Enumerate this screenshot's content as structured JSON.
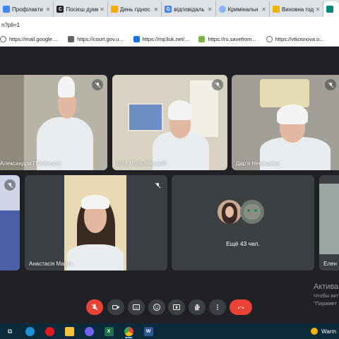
{
  "browser": {
    "tabs": [
      {
        "title": "Профілакти",
        "favicon": "doc-icon",
        "color": "#4285f4",
        "glyph": ""
      },
      {
        "title": "Посієш думк",
        "favicon": "site-icon",
        "color": "#202124",
        "glyph": "C"
      },
      {
        "title": "День гіднос",
        "favicon": "bookmark-icon",
        "color": "#f9ab00",
        "glyph": ""
      },
      {
        "title": "відповідаль",
        "favicon": "google-icon",
        "color": "#4285f4",
        "glyph": "G"
      },
      {
        "title": "Кримінальн",
        "favicon": "loading-icon",
        "color": "#8ab4f8",
        "glyph": ""
      },
      {
        "title": "Виховна год",
        "favicon": "bell-icon",
        "color": "#f4b400",
        "glyph": ""
      }
    ],
    "active_tab_favicon": "meet-icon",
    "address": "n?pli=1",
    "bookmarks": [
      {
        "label": "https://mail.google....",
        "icon": "globe-icon"
      },
      {
        "label": "https://court.gov.u...",
        "icon": "scale-icon"
      },
      {
        "label": "https://mp3uk.net/...",
        "icon": "music-icon"
      },
      {
        "label": "https://ru.savefrom...",
        "icon": "download-icon"
      },
      {
        "label": "https://vtkosnova.o...",
        "icon": "globe-icon"
      }
    ]
  },
  "meet": {
    "participants": [
      {
        "name": "Александра Полянская",
        "muted": true
      },
      {
        "name": "Ілля Могилевський",
        "muted": true
      },
      {
        "name": "Дар'я Немешева",
        "muted": true
      },
      {
        "name": "",
        "muted": true
      },
      {
        "name": "Анастасія Манта",
        "muted": true
      },
      {
        "name": "Елен",
        "muted": false
      }
    ],
    "more_label": "Ещё 43 чел.",
    "controls": [
      "mic-off-icon",
      "camera-icon",
      "captions-icon",
      "emoji-icon",
      "present-icon",
      "hand-icon",
      "more-icon",
      "end-call-icon"
    ]
  },
  "watermark": {
    "title": "Актива",
    "line1": "Чтобы акт",
    "line2": "\"Парамет"
  },
  "taskbar": {
    "items": [
      "task-view-icon",
      "edge-icon",
      "opera-icon",
      "explorer-icon",
      "viber-icon",
      "excel-icon",
      "chrome-icon",
      "word-icon"
    ],
    "weather": "Warm"
  },
  "colors": {
    "meet_bg": "#202124",
    "tile_bg": "#3c4043",
    "end_call": "#ea4335",
    "taskbar": "#0b2a3b"
  }
}
